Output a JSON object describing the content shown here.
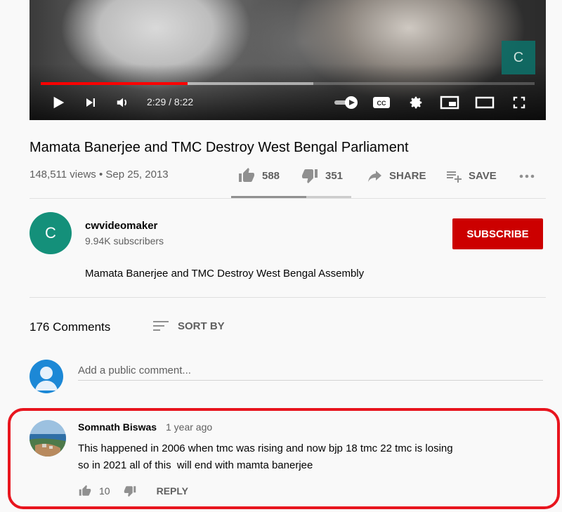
{
  "player": {
    "watermark": "C",
    "time_current": "2:29",
    "time_total": "8:22",
    "progress": 0.297,
    "buffered": 0.552
  },
  "video": {
    "title": "Mamata Banerjee and TMC Destroy West Bengal Parliament",
    "views": "148,511 views",
    "date": "Sep 25, 2013",
    "likes": "588",
    "dislikes": "351",
    "share_label": "SHARE",
    "save_label": "SAVE",
    "like_ratio": 0.626
  },
  "channel": {
    "avatar_letter": "C",
    "name": "cwvideomaker",
    "subscribers": "9.94K subscribers",
    "subscribe_label": "SUBSCRIBE",
    "description": "Mamata Banerjee and TMC Destroy West Bengal Assembly"
  },
  "comments": {
    "count_label": "176 Comments",
    "sort_label": "SORT BY",
    "add_placeholder": "Add a public comment...",
    "items": [
      {
        "author": "Somnath Biswas",
        "time": "1 year ago",
        "text_line1": "This happened in 2006 when tmc was rising and now bjp 18 tmc 22 tmc is losing",
        "text_line2": "so in 2021 all of this  will end with mamta banerjee",
        "likes": "10",
        "reply_label": "REPLY"
      }
    ]
  },
  "colors": {
    "accent_red": "#ff0000",
    "subscribe_bg": "#cc0000",
    "highlight_border": "#e8151e",
    "channel_avatar": "#14907a"
  }
}
